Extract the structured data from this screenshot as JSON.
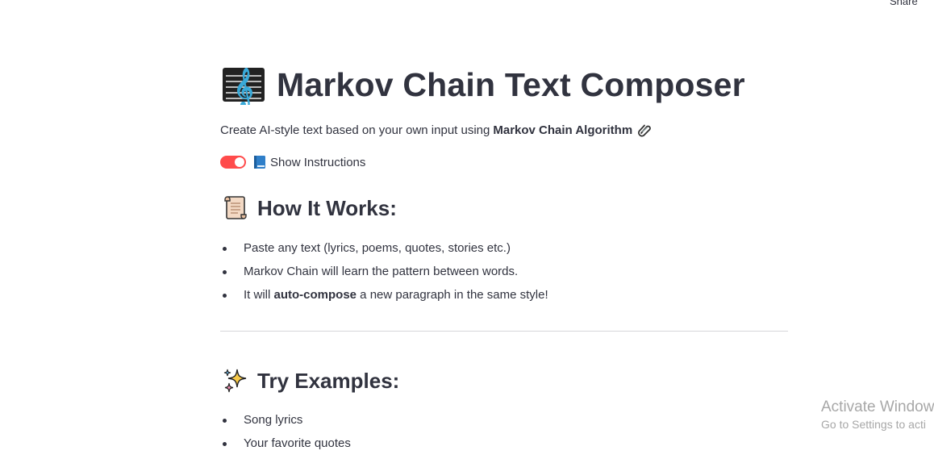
{
  "header": {
    "share_label": "Share"
  },
  "title": {
    "icon": "treble-clef-icon",
    "text": "Markov Chain Text Composer"
  },
  "subtitle": {
    "prefix": "Create AI-style text based on your own input using",
    "bold": "Markov Chain Algorithm",
    "icon": "paperclip-icon"
  },
  "toggle": {
    "checked": true,
    "icon": "blue-book-icon",
    "label": "Show Instructions",
    "accent": "#ff4b4b"
  },
  "how_it_works": {
    "icon": "scroll-icon",
    "heading": "How It Works:",
    "items": [
      {
        "text": "Paste any text (lyrics, poems, quotes, stories etc.)"
      },
      {
        "text": "Markov Chain will learn the pattern between words."
      },
      {
        "pre": "It will ",
        "bold": "auto-compose",
        "post": " a new paragraph in the same style!"
      }
    ]
  },
  "try_examples": {
    "icon": "sparkles-icon",
    "heading": "Try Examples:",
    "items": [
      "Song lyrics",
      "Your favorite quotes"
    ]
  },
  "watermark": {
    "line1": "Activate Window",
    "line2": "Go to Settings to acti"
  }
}
